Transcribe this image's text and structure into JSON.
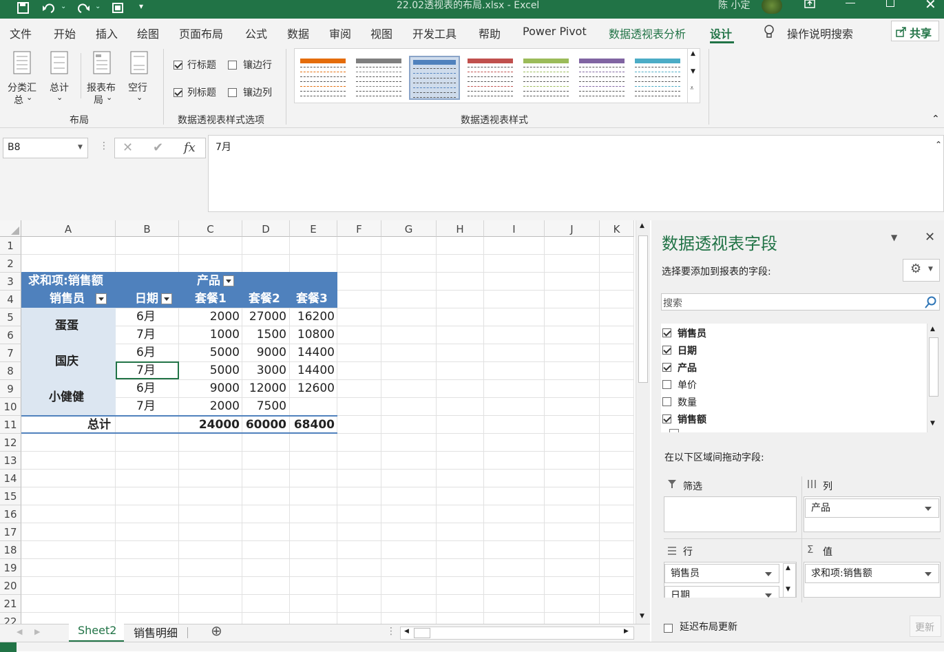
{
  "window": {
    "title": "22.02透视表的布局.xlsx  -  Excel",
    "user": "陈 小定"
  },
  "tabs": [
    "文件",
    "开始",
    "插入",
    "绘图",
    "页面布局",
    "公式",
    "数据",
    "审阅",
    "视图",
    "开发工具",
    "帮助",
    "Power Pivot",
    "数据透视表分析",
    "设计"
  ],
  "tell_me": "操作说明搜索",
  "share": "共享",
  "ribbon": {
    "layout": {
      "group": "布局",
      "subtotal": "分类汇",
      "subtotal2": "总",
      "grand": "总计",
      "report": "报表布",
      "report2": "局",
      "blank": "空行"
    },
    "options": {
      "group": "数据透视表样式选项",
      "row_headers": "行标题",
      "col_headers": "列标题",
      "banded_rows": "镶边行",
      "banded_cols": "镶边列"
    },
    "styles": {
      "group": "数据透视表样式",
      "colors": [
        "#e46c0a",
        "#7f7f7f",
        "#4f81bd",
        "#c0504d",
        "#9bbb59",
        "#8064a2",
        "#4bacc6"
      ]
    }
  },
  "formula": {
    "namebox": "B8",
    "value": "7月"
  },
  "columns": [
    "A",
    "B",
    "C",
    "D",
    "E",
    "F",
    "G",
    "H",
    "I",
    "J",
    "K"
  ],
  "rows": [
    "1",
    "2",
    "3",
    "4",
    "5",
    "6",
    "7",
    "8",
    "9",
    "10",
    "11",
    "12",
    "13",
    "14",
    "15",
    "16",
    "17",
    "18",
    "19",
    "20",
    "21",
    "22"
  ],
  "pivot": {
    "title": "求和项:销售额",
    "product_label": "产品",
    "salesperson_label": "销售员",
    "date_label": "日期",
    "col_heads": [
      "套餐1",
      "套餐2",
      "套餐3"
    ],
    "names": [
      "蛋蛋",
      "国庆",
      "小健健"
    ],
    "data": [
      [
        "6月",
        "2000",
        "27000",
        "16200"
      ],
      [
        "7月",
        "1000",
        "1500",
        "10800"
      ],
      [
        "6月",
        "5000",
        "9000",
        "14400"
      ],
      [
        "7月",
        "5000",
        "3000",
        "14400"
      ],
      [
        "6月",
        "9000",
        "12000",
        "12600"
      ],
      [
        "7月",
        "2000",
        "7500",
        ""
      ]
    ],
    "total_label": "总计",
    "totals": [
      "24000",
      "60000",
      "68400"
    ]
  },
  "field_pane": {
    "title": "数据透视表字段",
    "choose": "选择要添加到报表的字段:",
    "search_placeholder": "搜索",
    "fields": [
      {
        "name": "销售员",
        "checked": true
      },
      {
        "name": "日期",
        "checked": true
      },
      {
        "name": "产品",
        "checked": true
      },
      {
        "name": "单价",
        "checked": false
      },
      {
        "name": "数量",
        "checked": false
      },
      {
        "name": "销售额",
        "checked": true
      }
    ],
    "drag": "在以下区域间拖动字段:",
    "filter": "筛选",
    "columns": "列",
    "rows": "行",
    "values": "值",
    "col_field": "产品",
    "row_fields": [
      "销售员",
      "日期"
    ],
    "value_field": "求和项:销售额",
    "defer": "延迟布局更新",
    "update": "更新"
  },
  "sheets": [
    "Sheet2",
    "销售明细"
  ]
}
